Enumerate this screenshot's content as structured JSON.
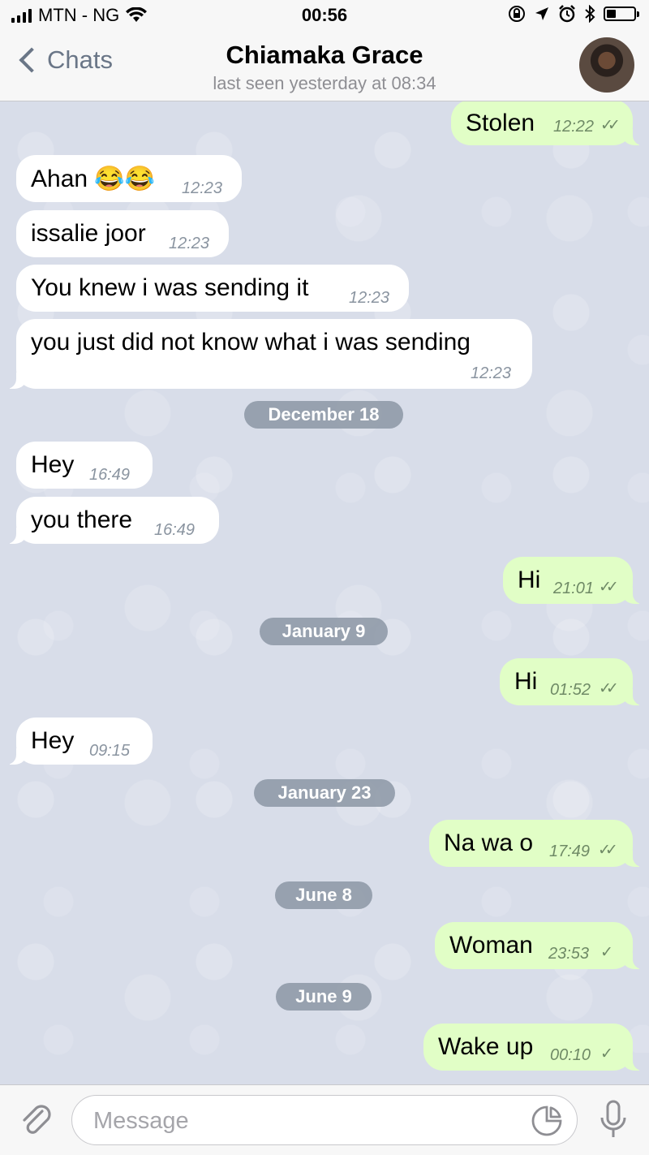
{
  "status_bar": {
    "carrier": "MTN - NG",
    "time": "00:56",
    "battery_level": 0.35
  },
  "header": {
    "back_label": "Chats",
    "title": "Chiamaka Grace",
    "subtitle": "last seen yesterday at 08:34"
  },
  "messages": [
    {
      "dir": "out",
      "text": "Stolen",
      "time": "12:22",
      "status": "read"
    },
    {
      "dir": "in",
      "text": "Ahan 😂😂",
      "time": "12:23"
    },
    {
      "dir": "in",
      "text": "issalie joor",
      "time": "12:23"
    },
    {
      "dir": "in",
      "text": "You knew i was sending it",
      "time": "12:23"
    },
    {
      "dir": "in",
      "text": "you just did not know what i was sending",
      "time": "12:23"
    },
    {
      "date": "December 18"
    },
    {
      "dir": "in",
      "text": "Hey",
      "time": "16:49"
    },
    {
      "dir": "in",
      "text": "you there",
      "time": "16:49"
    },
    {
      "dir": "out",
      "text": "Hi",
      "time": "21:01",
      "status": "read"
    },
    {
      "date": "January 9"
    },
    {
      "dir": "out",
      "text": "Hi",
      "time": "01:52",
      "status": "read"
    },
    {
      "dir": "in",
      "text": "Hey",
      "time": "09:15"
    },
    {
      "date": "January 23"
    },
    {
      "dir": "out",
      "text": "Na wa o",
      "time": "17:49",
      "status": "read"
    },
    {
      "date": "June 8"
    },
    {
      "dir": "out",
      "text": "Woman",
      "time": "23:53",
      "status": "sent"
    },
    {
      "date": "June 9"
    },
    {
      "dir": "out",
      "text": "Wake up",
      "time": "00:10",
      "status": "sent"
    }
  ],
  "composer": {
    "placeholder": "Message"
  },
  "colors": {
    "incoming_bubble": "#ffffff",
    "outgoing_bubble": "#e1fec6",
    "accent": "#6a7687",
    "chat_background": "#d8dde9"
  }
}
